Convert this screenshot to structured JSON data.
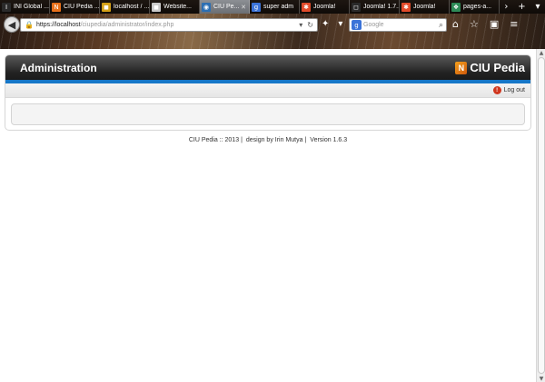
{
  "browser": {
    "tabs": [
      {
        "title": "INI Global ...",
        "favicon": "I",
        "fav_color": "#2a2a2a",
        "active": false
      },
      {
        "title": "CIU Pedia ...",
        "favicon": "N",
        "fav_color": "#e8701a",
        "active": false
      },
      {
        "title": "localhost / ...",
        "favicon": "◼",
        "fav_color": "#d4a017",
        "active": false
      },
      {
        "title": "Website...",
        "favicon": "◼",
        "fav_color": "#c9c9c9",
        "active": false
      },
      {
        "title": "CIU Pe...",
        "favicon": "◉",
        "fav_color": "#2c6fb3",
        "active": true
      },
      {
        "title": "super adm",
        "favicon": "g",
        "fav_color": "#3b73d8",
        "active": false
      },
      {
        "title": "Joomla!",
        "favicon": "✱",
        "fav_color": "#e24b2a",
        "active": false
      },
      {
        "title": "Joomla! 1.7...",
        "favicon": "◻",
        "fav_color": "#2a2a2a",
        "active": false
      },
      {
        "title": "Joomla!",
        "favicon": "✱",
        "fav_color": "#e24b2a",
        "active": false
      },
      {
        "title": "pages-a...",
        "favicon": "❖",
        "fav_color": "#2e8b57",
        "active": false
      }
    ],
    "tab_close_glyph": "✕",
    "tab_scroll_glyph": "›",
    "new_tab_glyph": "+",
    "tab_list_glyph": "▾",
    "url_host": "https://localhost",
    "url_path": "/ciupedia/administrator/index.php",
    "search_placeholder": "Google"
  },
  "admin": {
    "title": "Administration",
    "logo_mark": "N",
    "logo_text": "CIU Pedia",
    "logout_label": "Log out",
    "logout_glyph": "!"
  },
  "footer": {
    "copyright": "CIU Pedia :: 2013",
    "design": "design by Irin Mutya",
    "version": "Version 1.6.3"
  },
  "colors": {
    "accent_stripe": "#1677c8",
    "header_dark": "#232323",
    "logout_icon": "#d0361e"
  }
}
